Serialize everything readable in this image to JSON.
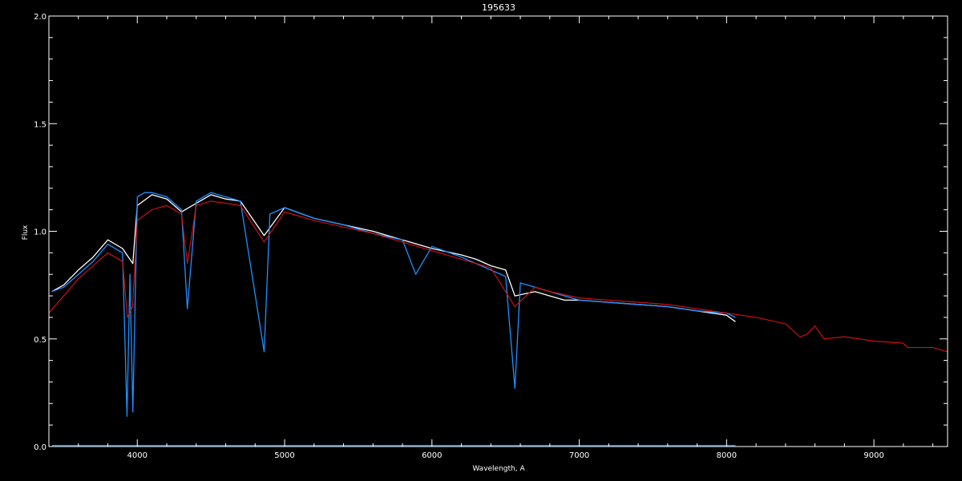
{
  "chart_data": {
    "type": "line",
    "title": "195633",
    "xlabel": "Wavelength, A",
    "ylabel": "Flux",
    "xlim": [
      3400,
      9500
    ],
    "ylim": [
      0.0,
      2.0
    ],
    "xticks": [
      4000,
      5000,
      6000,
      7000,
      8000,
      9000
    ],
    "xtick_labels": [
      "4000",
      "5000",
      "6000",
      "7000",
      "8000",
      "9000"
    ],
    "yticks": [
      0.0,
      0.5,
      1.0,
      1.5,
      2.0
    ],
    "ytick_labels": [
      "0.0",
      "0.5",
      "1.0",
      "1.5",
      "2.0"
    ],
    "grid": false,
    "colors": {
      "background": "#000000",
      "axes": "#ffffff",
      "observed_white": "#ffffff",
      "observed_blue": "#1e90ff",
      "model_red": "#dd1111"
    },
    "series": [
      {
        "color": "white",
        "x": [
          3420,
          3500,
          3600,
          3700,
          3800,
          3900,
          3970,
          4000,
          4100,
          4200,
          4300,
          4400,
          4500,
          4600,
          4700,
          4861,
          5000,
          5200,
          5400,
          5600,
          5800,
          6000,
          6200,
          6300,
          6400,
          6500,
          6563,
          6700,
          6800,
          6900,
          7000,
          7200,
          7400,
          7600,
          7800,
          8000,
          8060
        ],
        "y": [
          0.72,
          0.75,
          0.82,
          0.88,
          0.96,
          0.92,
          0.85,
          1.12,
          1.17,
          1.15,
          1.09,
          1.13,
          1.17,
          1.15,
          1.14,
          0.98,
          1.11,
          1.06,
          1.03,
          1.0,
          0.96,
          0.92,
          0.89,
          0.87,
          0.84,
          0.82,
          0.7,
          0.72,
          0.7,
          0.68,
          0.68,
          0.67,
          0.66,
          0.65,
          0.63,
          0.61,
          0.58
        ]
      },
      {
        "color": "blue",
        "x": [
          3420,
          3500,
          3600,
          3700,
          3800,
          3900,
          3930,
          3950,
          3970,
          4000,
          4050,
          4100,
          4200,
          4300,
          4340,
          4400,
          4500,
          4600,
          4700,
          4861,
          4900,
          5000,
          5200,
          5400,
          5600,
          5800,
          5890,
          6000,
          6200,
          6300,
          6400,
          6500,
          6563,
          6600,
          6700,
          6800,
          6900,
          7000,
          7200,
          7400,
          7600,
          7800,
          8000,
          8060
        ],
        "y": [
          0.72,
          0.74,
          0.8,
          0.86,
          0.94,
          0.9,
          0.14,
          0.8,
          0.16,
          1.16,
          1.18,
          1.18,
          1.16,
          1.1,
          0.64,
          1.14,
          1.18,
          1.16,
          1.14,
          0.44,
          1.08,
          1.11,
          1.06,
          1.03,
          0.99,
          0.96,
          0.8,
          0.93,
          0.88,
          0.85,
          0.82,
          0.79,
          0.27,
          0.76,
          0.74,
          0.72,
          0.7,
          0.68,
          0.67,
          0.66,
          0.65,
          0.63,
          0.62,
          0.6
        ]
      },
      {
        "color": "red",
        "x": [
          3400,
          3500,
          3600,
          3700,
          3800,
          3900,
          3933,
          3968,
          4000,
          4100,
          4200,
          4300,
          4340,
          4400,
          4500,
          4600,
          4700,
          4861,
          5000,
          5200,
          5400,
          5600,
          5800,
          6000,
          6200,
          6400,
          6563,
          6700,
          6800,
          7000,
          7200,
          7400,
          7600,
          7800,
          8000,
          8200,
          8400,
          8498,
          8542,
          8600,
          8662,
          8800,
          9000,
          9200,
          9229,
          9400,
          9500
        ],
        "y": [
          0.62,
          0.7,
          0.78,
          0.84,
          0.9,
          0.86,
          0.6,
          0.65,
          1.05,
          1.1,
          1.12,
          1.08,
          0.85,
          1.12,
          1.14,
          1.13,
          1.12,
          0.95,
          1.09,
          1.05,
          1.02,
          0.99,
          0.95,
          0.91,
          0.87,
          0.83,
          0.65,
          0.74,
          0.72,
          0.69,
          0.68,
          0.67,
          0.66,
          0.64,
          0.62,
          0.6,
          0.57,
          0.51,
          0.52,
          0.56,
          0.5,
          0.51,
          0.49,
          0.48,
          0.46,
          0.46,
          0.44
        ]
      },
      {
        "color": "blue-error",
        "x": [
          3420,
          8060
        ],
        "y": [
          0.005,
          0.005
        ]
      }
    ]
  }
}
